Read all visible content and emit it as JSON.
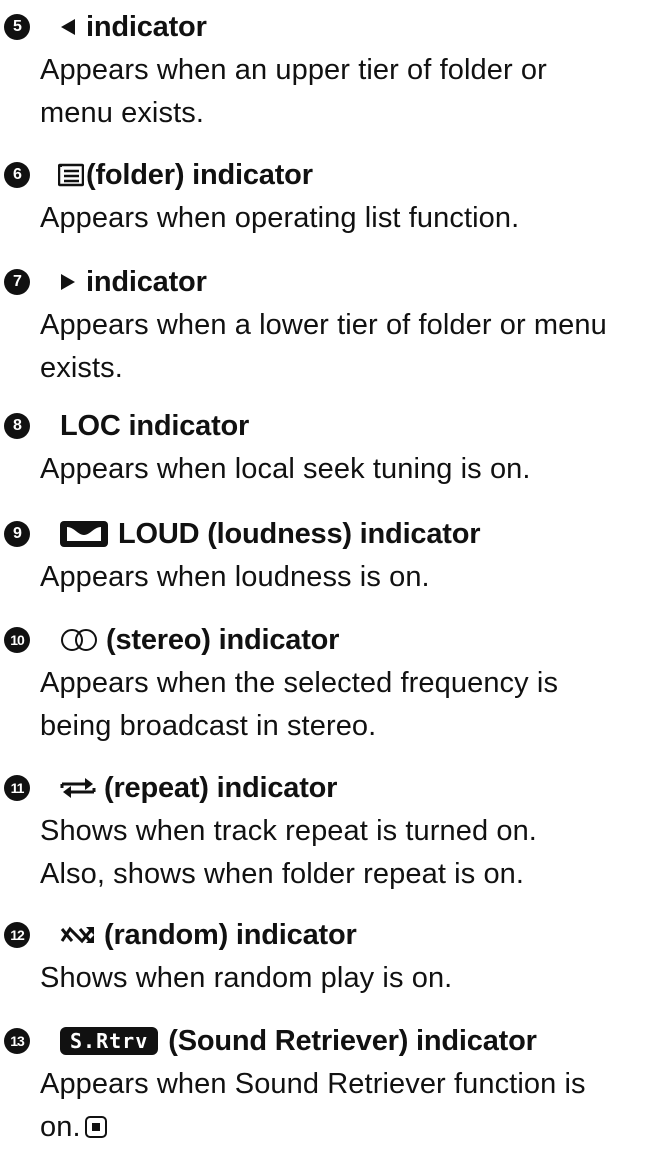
{
  "entries": [
    {
      "number": "5",
      "icon": "left-triangle-icon",
      "heading": "indicator",
      "desc": [
        "Appears when an upper tier of folder or",
        "menu exists."
      ]
    },
    {
      "number": "6",
      "icon": "list-folder-icon",
      "heading": "(folder) indicator",
      "desc": [
        "Appears when operating list function."
      ]
    },
    {
      "number": "7",
      "icon": "right-triangle-icon",
      "heading": "indicator",
      "desc": [
        "Appears when a lower tier of folder or menu",
        "exists."
      ]
    },
    {
      "number": "8",
      "icon": "",
      "heading": "LOC indicator",
      "desc": [
        "Appears when local seek tuning is on."
      ]
    },
    {
      "number": "9",
      "icon": "loudness-icon",
      "heading": "LOUD (loudness) indicator",
      "desc": [
        "Appears when loudness is on."
      ]
    },
    {
      "number": "10",
      "icon": "stereo-icon",
      "heading": "(stereo) indicator",
      "desc": [
        "Appears when the selected frequency is",
        "being broadcast in stereo."
      ]
    },
    {
      "number": "11",
      "icon": "repeat-icon",
      "heading": "(repeat) indicator",
      "desc": [
        "Shows when track repeat is turned on.",
        "Also, shows when folder repeat is on."
      ]
    },
    {
      "number": "12",
      "icon": "random-icon",
      "heading": "(random) indicator",
      "desc": [
        "Shows when random play is on."
      ]
    },
    {
      "number": "13",
      "icon": "sound-retriever-icon",
      "badge": "S.Rtrv",
      "heading": "(Sound Retriever) indicator",
      "desc": [
        "Appears when Sound Retriever function is",
        "on."
      ],
      "end_icon": "end-of-section-icon"
    }
  ]
}
